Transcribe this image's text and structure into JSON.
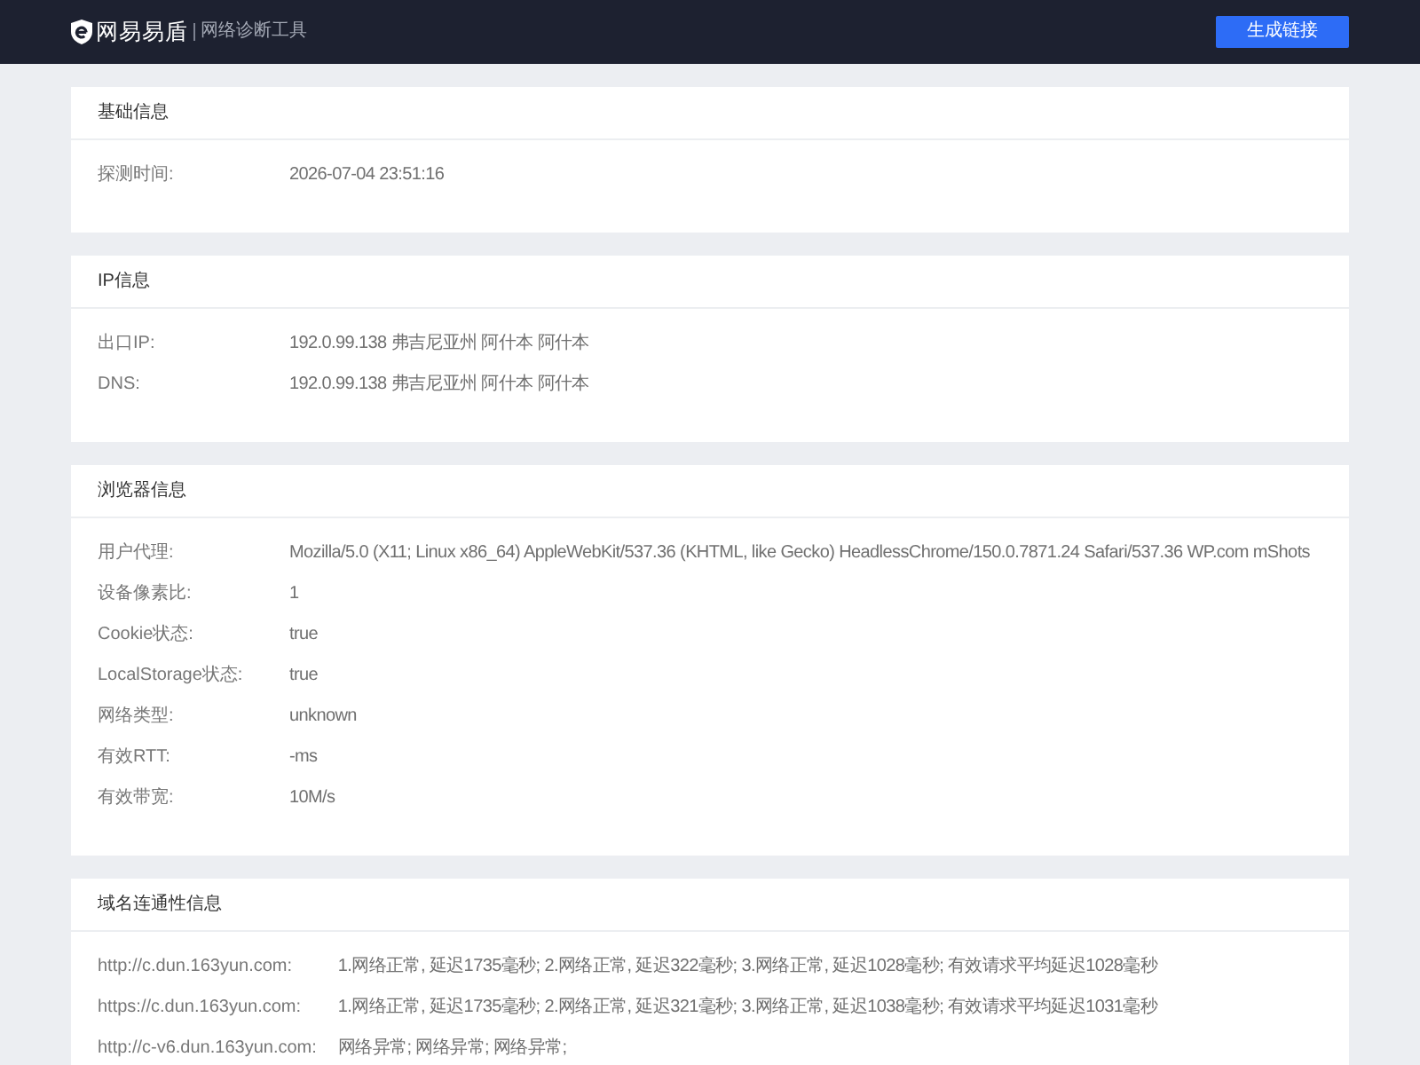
{
  "header": {
    "brand": "网易易盾",
    "subtitle": "网络诊断工具",
    "button": "生成链接"
  },
  "sections": [
    {
      "title": "基础信息",
      "rows": [
        {
          "label": "探测时间:",
          "value": "2026-07-04 23:51:16"
        }
      ]
    },
    {
      "title": "IP信息",
      "rows": [
        {
          "label": "出口IP:",
          "value": "192.0.99.138 弗吉尼亚州 阿什本 阿什本"
        },
        {
          "label": "DNS:",
          "value": "192.0.99.138 弗吉尼亚州 阿什本 阿什本"
        }
      ]
    },
    {
      "title": "浏览器信息",
      "rows": [
        {
          "label": "用户代理:",
          "value": "Mozilla/5.0 (X11; Linux x86_64) AppleWebKit/537.36 (KHTML, like Gecko) HeadlessChrome/150.0.7871.24 Safari/537.36 WP.com mShots"
        },
        {
          "label": "设备像素比:",
          "value": "1"
        },
        {
          "label": "Cookie状态:",
          "value": "true"
        },
        {
          "label": "LocalStorage状态:",
          "value": "true"
        },
        {
          "label": "网络类型:",
          "value": "unknown"
        },
        {
          "label": "有效RTT:",
          "value": "-ms"
        },
        {
          "label": "有效带宽:",
          "value": "10M/s"
        }
      ]
    },
    {
      "title": "域名连通性信息",
      "rows": [
        {
          "label": "http://c.dun.163yun.com:",
          "value": "1.网络正常, 延迟1735毫秒; 2.网络正常, 延迟322毫秒; 3.网络正常, 延迟1028毫秒; 有效请求平均延迟1028毫秒"
        },
        {
          "label": "https://c.dun.163yun.com:",
          "value": "1.网络正常, 延迟1735毫秒; 2.网络正常, 延迟321毫秒; 3.网络正常, 延迟1038毫秒; 有效请求平均延迟1031毫秒"
        },
        {
          "label": "http://c-v6.dun.163yun.com:",
          "value": "网络异常; 网络异常; 网络异常;"
        }
      ]
    }
  ]
}
